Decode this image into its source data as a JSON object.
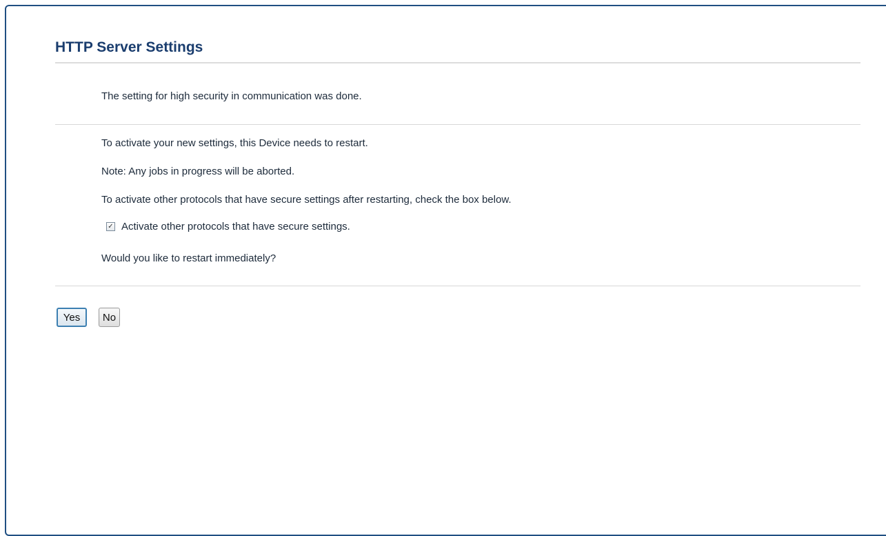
{
  "page": {
    "title": "HTTP Server Settings"
  },
  "messages": {
    "done": "The setting for high security in communication was done.",
    "restart_needed": "To activate your new settings, this Device needs to restart.",
    "note": "Note: Any jobs in progress will be aborted.",
    "activate_other": "To activate other protocols that have secure settings after restarting, check the box below.",
    "question": "Would you like to restart immediately?"
  },
  "checkbox": {
    "label": "Activate other protocols that have secure settings.",
    "checked": true,
    "glyph": "✓"
  },
  "buttons": {
    "yes_label": "Yes",
    "no_label": "No"
  },
  "colors": {
    "title": "#1a3d6e",
    "frame_border": "#1f4f82",
    "text": "#1c2a3a",
    "focus_border": "#3c7fb1"
  }
}
